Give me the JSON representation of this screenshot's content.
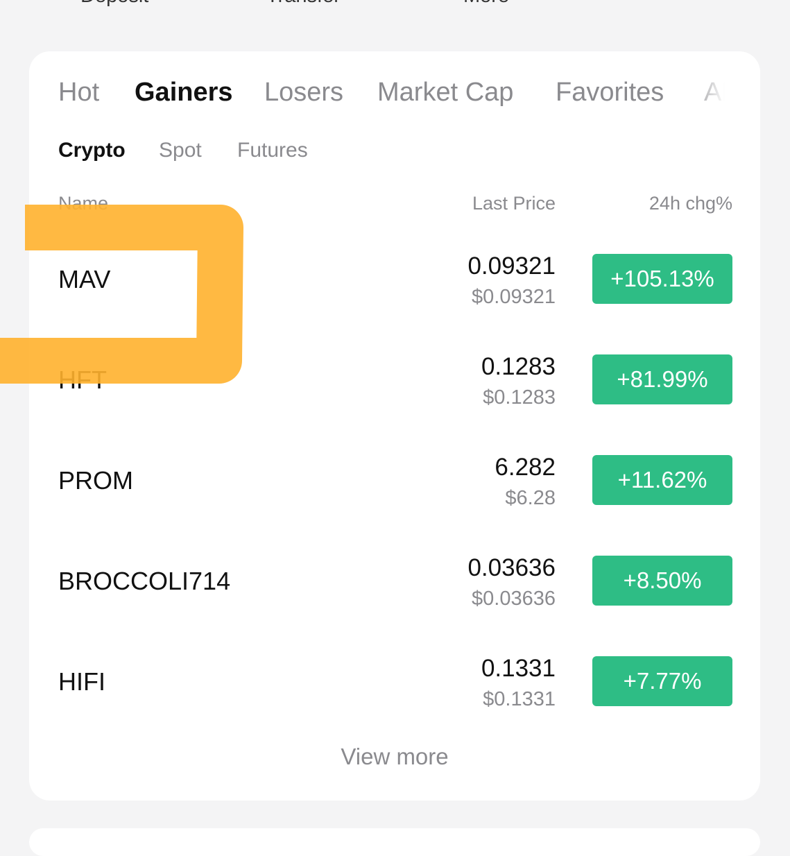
{
  "quick_actions": {
    "deposit": "Deposit",
    "transfer": "Transfer",
    "more": "More"
  },
  "tabs": [
    {
      "label": "Hot",
      "active": false
    },
    {
      "label": "Gainers",
      "active": true
    },
    {
      "label": "Losers",
      "active": false
    },
    {
      "label": "Market Cap",
      "active": false
    },
    {
      "label": "Favorites",
      "active": false
    },
    {
      "label": "AI",
      "active": false
    }
  ],
  "subtabs": [
    {
      "label": "Crypto",
      "active": true
    },
    {
      "label": "Spot",
      "active": false
    },
    {
      "label": "Futures",
      "active": false
    }
  ],
  "columns": {
    "name": "Name",
    "last_price": "Last Price",
    "change": "24h chg%"
  },
  "rows": [
    {
      "name": "MAV",
      "price": "0.09321",
      "price_usd": "$0.09321",
      "change": "+105.13%"
    },
    {
      "name": "HFT",
      "price": "0.1283",
      "price_usd": "$0.1283",
      "change": "+81.99%"
    },
    {
      "name": "PROM",
      "price": "6.282",
      "price_usd": "$6.28",
      "change": "+11.62%"
    },
    {
      "name": "BROCCOLI714",
      "price": "0.03636",
      "price_usd": "$0.03636",
      "change": "+8.50%"
    },
    {
      "name": "HIFI",
      "price": "0.1331",
      "price_usd": "$0.1331",
      "change": "+7.77%"
    }
  ],
  "view_more": "View more",
  "colors": {
    "gain": "#2ebd85",
    "highlight": "#ffb12e"
  }
}
